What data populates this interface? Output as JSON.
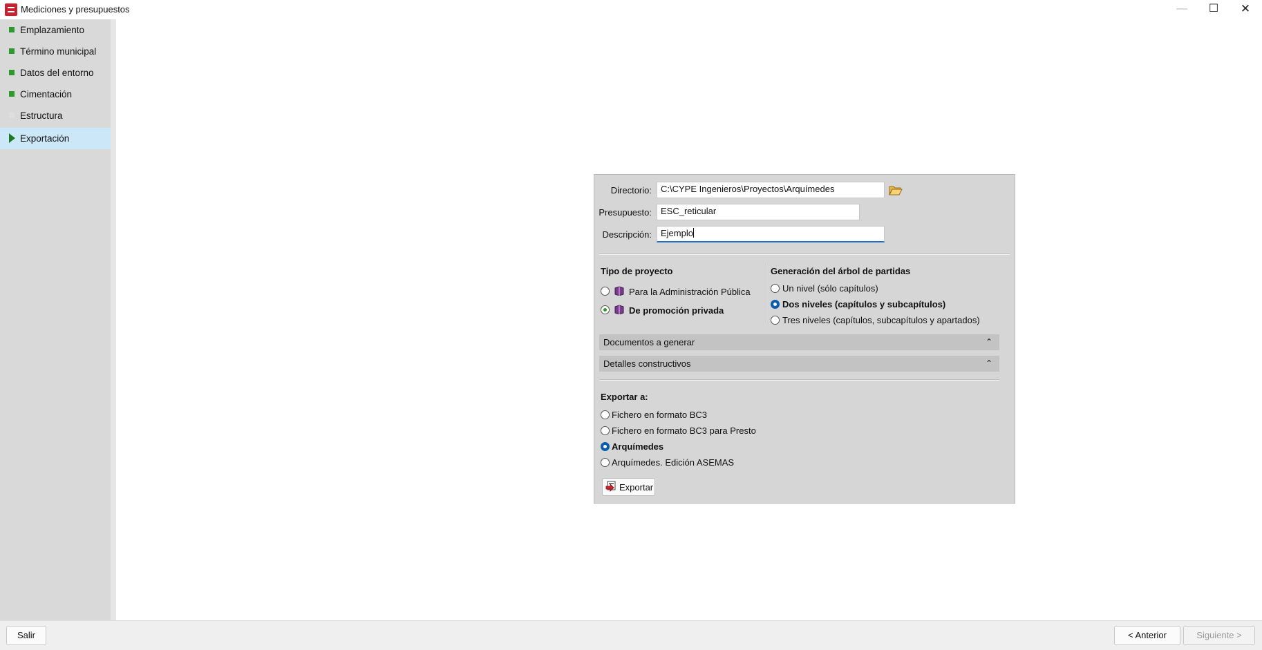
{
  "window": {
    "title": "Mediciones y presupuestos",
    "minimize_icon": "—",
    "maximize_icon": "☐",
    "close_icon": "✕"
  },
  "sidebar": {
    "items": [
      {
        "label": "Emplazamiento",
        "status": "complete"
      },
      {
        "label": "Término municipal",
        "status": "complete"
      },
      {
        "label": "Datos del entorno",
        "status": "complete"
      },
      {
        "label": "Cimentación",
        "status": "complete"
      },
      {
        "label": "Estructura",
        "status": "empty"
      },
      {
        "label": "Exportación",
        "status": "active"
      }
    ]
  },
  "form": {
    "directorio_label": "Directorio:",
    "directorio_value": "C:\\CYPE Ingenieros\\Proyectos\\Arquímedes",
    "presupuesto_label": "Presupuesto:",
    "presupuesto_value": "ESC_reticular",
    "descripcion_label": "Descripción:",
    "descripcion_value": "Ejemplo"
  },
  "tipo_proyecto": {
    "title": "Tipo de proyecto",
    "options": [
      {
        "label": "Para la Administración Pública",
        "selected": false
      },
      {
        "label": "De promoción privada",
        "selected": true
      }
    ]
  },
  "arbol_partidas": {
    "title": "Generación del árbol de partidas",
    "options": [
      {
        "label": "Un nivel (sólo capítulos)",
        "selected": false
      },
      {
        "label": "Dos niveles (capítulos y subcapítulos)",
        "selected": true
      },
      {
        "label": "Tres niveles (capítulos, subcapítulos y apartados)",
        "selected": false
      }
    ]
  },
  "sections": {
    "documentos": "Documentos a generar",
    "detalles": "Detalles constructivos",
    "chevron": "⌃"
  },
  "exportar": {
    "title": "Exportar a:",
    "options": [
      {
        "label": "Fichero en formato BC3",
        "selected": false
      },
      {
        "label": "Fichero en formato BC3 para Presto",
        "selected": false
      },
      {
        "label": "Arquímedes",
        "selected": true
      },
      {
        "label": "Arquímedes. Edición ASEMAS",
        "selected": false
      }
    ],
    "button_label": "Exportar"
  },
  "footer": {
    "salir": "Salir",
    "anterior": "< Anterior",
    "siguiente": "Siguiente >"
  },
  "colors": {
    "accent": "#0b5cad",
    "complete": "#2d9a2d",
    "active_bg": "#cce8f8"
  }
}
